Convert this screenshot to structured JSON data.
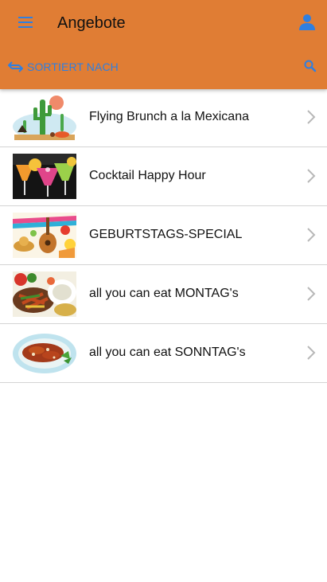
{
  "header": {
    "title": "Angebote",
    "menu_icon": "hamburger-menu-icon",
    "account_icon": "user-account-icon",
    "background_color": "#e07d34",
    "accent_color": "#2f7fe0"
  },
  "toolbar": {
    "sort_label": "SORTIERT NACH",
    "sort_icon": "swap-arrows-icon",
    "search_icon": "search-icon"
  },
  "offers": [
    {
      "label": "Flying Brunch a la Mexicana",
      "thumbnail": "cactus-desert-illustration"
    },
    {
      "label": "Cocktail Happy Hour",
      "thumbnail": "cocktail-glasses-photo"
    },
    {
      "label": "GEBURTSTAGS-SPECIAL",
      "thumbnail": "fiesta-guitar-sombrero-illustration"
    },
    {
      "label": "all you can eat MONTAG's",
      "thumbnail": "fajitas-platter-photo"
    },
    {
      "label": "all you can eat SONNTAG's",
      "thumbnail": "enchilada-plate-photo"
    }
  ]
}
